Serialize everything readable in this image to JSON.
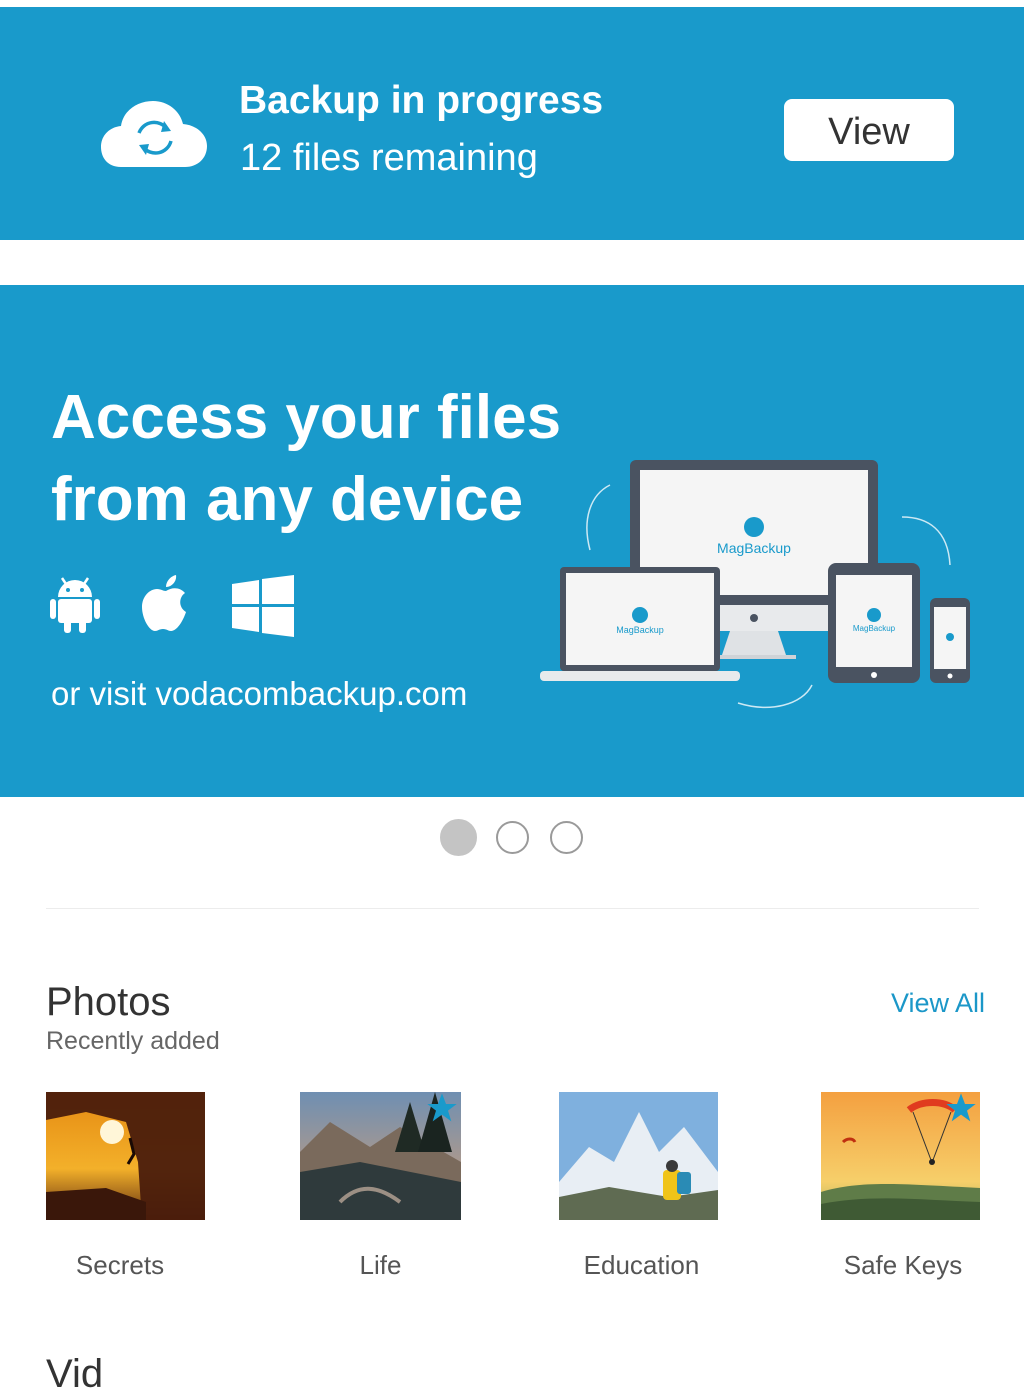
{
  "backup": {
    "title": "Backup in progress",
    "subtitle": "12 files remaining",
    "view_label": "View",
    "icon": "cloud-sync-icon"
  },
  "promo": {
    "headline_line1": "Access your files",
    "headline_line2": "from any device",
    "platforms": [
      "android-icon",
      "apple-icon",
      "windows-icon"
    ],
    "visit_text": "or visit vodacombackup.com",
    "device_brand": "MagBackup",
    "slides_count": 3,
    "active_slide": 1
  },
  "photos": {
    "title": "Photos",
    "subtitle": "Recently added",
    "view_all_label": "View All",
    "items": [
      {
        "label": "Secrets",
        "starred": false
      },
      {
        "label": "Life",
        "starred": true
      },
      {
        "label": "Education",
        "starred": false
      },
      {
        "label": "Safe Keys",
        "starred": true
      }
    ]
  },
  "next_section": {
    "title": "Vid"
  },
  "colors": {
    "brand_blue": "#199acb",
    "link_blue": "#1b97c8"
  }
}
